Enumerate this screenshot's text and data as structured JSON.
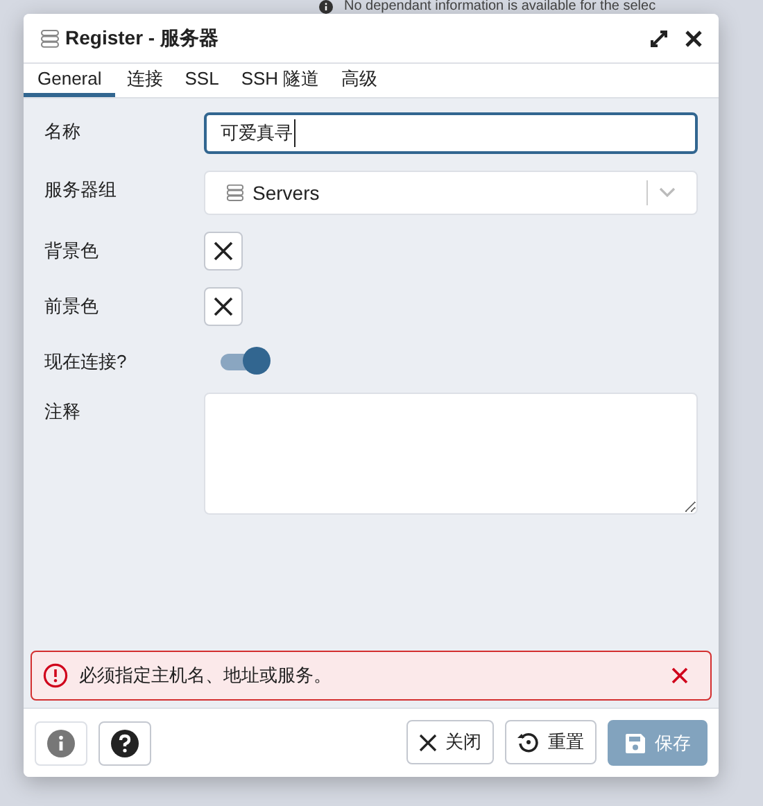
{
  "background_message": "No dependant information is available for the selec",
  "dialog": {
    "title": "Register - 服务器"
  },
  "tabs": [
    {
      "label": "General",
      "selected": true
    },
    {
      "label": "连接",
      "selected": false
    },
    {
      "label": "SSL",
      "selected": false
    },
    {
      "label": "SSH 隧道",
      "selected": false
    },
    {
      "label": "高级",
      "selected": false
    }
  ],
  "fields": [
    {
      "kind": "text",
      "label": "名称",
      "value": "可爱真寻"
    },
    {
      "kind": "select",
      "label": "服务器组",
      "value": "Servers"
    },
    {
      "kind": "color",
      "label": "背景色"
    },
    {
      "kind": "color",
      "label": "前景色"
    },
    {
      "kind": "switch",
      "label": "现在连接?",
      "on": true
    },
    {
      "kind": "textarea",
      "label": "注释"
    }
  ],
  "error": "必须指定主机名、地址或服务。",
  "buttons": [
    {
      "label": "关闭",
      "kind": "close"
    },
    {
      "label": "重置",
      "kind": "reset"
    },
    {
      "label": "保存",
      "kind": "save",
      "disabled": true
    }
  ]
}
